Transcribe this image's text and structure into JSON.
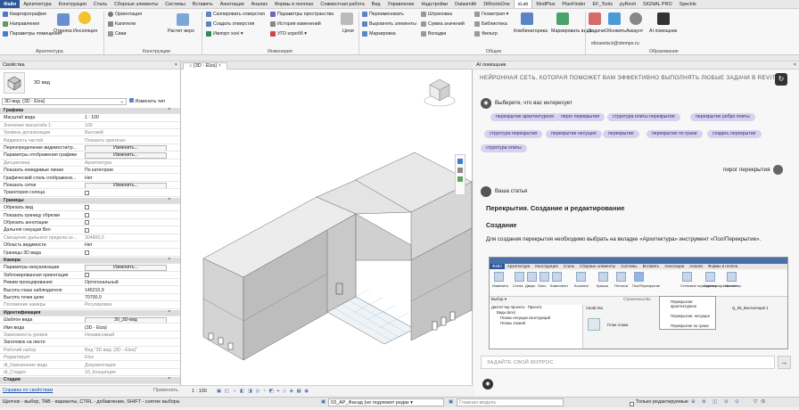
{
  "menu": [
    "Файл",
    "Архитектура",
    "Конструкция",
    "Сталь",
    "Сборные элементы",
    "Системы",
    "Вставить",
    "Аннотации",
    "Анализ",
    "Формы и генплан",
    "Совместная работа",
    "Вид",
    "Управление",
    "Надстройки",
    "Datasmith",
    "DiRootsOne",
    "sLab",
    "ModPlus",
    "PlanFinder",
    "EF_Tools",
    "pyRevit",
    "SIGNAL PRO",
    "Speckle"
  ],
  "menu_active": "sLab",
  "ribbon": {
    "col1": [
      "Квартирография",
      "Направления",
      "Параметры помещения"
    ],
    "g1_big": [
      "Отделка",
      "Инсоляция"
    ],
    "col2": [
      "Ориентация",
      "Капители",
      "Сваи"
    ],
    "g2_big": "Расчет веро",
    "col3": [
      "Скопировать отверстия",
      "Создать отверстия",
      "Импорт xcel ▾"
    ],
    "col4": [
      "Параметры пространства",
      "История изменений",
      "УГО коробб ▾"
    ],
    "g3_big": "Цепи",
    "col5": [
      "Переименовать",
      "Выровнять элементы",
      "Маркировка"
    ],
    "col6": [
      "Штриховка",
      "Сумма значений",
      "Вкладки"
    ],
    "col7": [
      "Геометрия ▾",
      "Библиотека",
      "Фильтр"
    ],
    "g4_big": [
      "Комбинаторика",
      "Маркировать виды"
    ],
    "g5_big": [
      "Задачи",
      "Обновить",
      "Аккаунт",
      "AI помощник"
    ],
    "email": "elizaveta.k@stemps.ru",
    "groups": [
      "Архитектура",
      "Конструкции",
      "Инженерия",
      "Общее",
      "Образование"
    ]
  },
  "properties": {
    "title": "Свойства",
    "close": "×",
    "type_name": "3D вид",
    "selector": "3D вид: {3D - Elza}",
    "edit_type": "Изменить тип",
    "rows": [
      {
        "k": "Графика",
        "v": "",
        "t": "section"
      },
      {
        "k": "Масштаб вида",
        "v": "1 : 100"
      },
      {
        "k": "Значение масштаба   1:",
        "v": "100",
        "t": "grey"
      },
      {
        "k": "Уровень детализации",
        "v": "Высокий",
        "t": "grey"
      },
      {
        "k": "Видимость частей",
        "v": "Показать оригинал",
        "t": "grey"
      },
      {
        "k": "Переопределение видимости/гр...",
        "v": "Изменить...",
        "t": "btn"
      },
      {
        "k": "Параметры отображения графики",
        "v": "Изменить...",
        "t": "btn"
      },
      {
        "k": "Дисциплина",
        "v": "Архитектура",
        "t": "grey"
      },
      {
        "k": "Показать невидимые линии",
        "v": "По категории"
      },
      {
        "k": "Графический стиль отображени...",
        "v": "Нет"
      },
      {
        "k": "Показать сетки",
        "v": "Изменить...",
        "t": "btn"
      },
      {
        "k": "Траектория солнца",
        "v": "",
        "t": "chk"
      },
      {
        "k": "Границы",
        "v": "",
        "t": "section"
      },
      {
        "k": "Обрезать вид",
        "v": "",
        "t": "chk"
      },
      {
        "k": "Показать границу обрезки",
        "v": "",
        "t": "chk"
      },
      {
        "k": "Обрезать аннотации",
        "v": "",
        "t": "chk"
      },
      {
        "k": "Дальняя секущая Вкл",
        "v": "",
        "t": "chk"
      },
      {
        "k": "Смещение дальнего предела се...",
        "v": "304800,0",
        "t": "grey"
      },
      {
        "k": "Область видимости",
        "v": "Нет"
      },
      {
        "k": "Границы 3D вида",
        "v": "",
        "t": "chk"
      },
      {
        "k": "Камера",
        "v": "",
        "t": "section"
      },
      {
        "k": "Параметры визуализации",
        "v": "Изменить...",
        "t": "btn"
      },
      {
        "k": "Заблокированная ориентация",
        "v": "",
        "t": "chk"
      },
      {
        "k": "Режим проецирования",
        "v": "Ортогональный"
      },
      {
        "k": "Высота глаза наблюдателя",
        "v": "145210,9"
      },
      {
        "k": "Высота точки цели",
        "v": "70700,0"
      },
      {
        "k": "Положение камеры",
        "v": "Регулировка",
        "t": "grey"
      },
      {
        "k": "Идентификация",
        "v": "",
        "t": "section"
      },
      {
        "k": "Шаблон вида",
        "v": "30_3D-вид",
        "t": "btn"
      },
      {
        "k": "Имя вида",
        "v": "{3D - Elza}"
      },
      {
        "k": "Зависимость уровня",
        "v": "Независимый",
        "t": "grey"
      },
      {
        "k": "Заголовок на листе",
        "v": ""
      },
      {
        "k": "Рабочий набор",
        "v": "Вид \"3D вид: {3D - Elza}\"",
        "t": "grey"
      },
      {
        "k": "Редактирует",
        "v": "Elza",
        "t": "grey"
      },
      {
        "k": "dt_Назначение вида",
        "v": "Документация",
        "t": "grey"
      },
      {
        "k": "dt_Стадия",
        "v": "10_Концепция",
        "t": "grey"
      },
      {
        "k": "Стадии",
        "v": "",
        "t": "section"
      }
    ],
    "help_link": "Справка по свойствам",
    "apply": "Применить"
  },
  "view": {
    "tab": "{3D - Elza}",
    "scale": "1 : 100"
  },
  "ai": {
    "title": "AI помощник",
    "close": "×",
    "banner": "НЕЙРОННАЯ СЕТЬ, КОТОРАЯ ПОМОЖЕТ ВАМ ЭФФЕКТИВНО ВЫПОЛНЯТЬ ЛЮБЫЕ ЗАДАЧИ В REVIT.",
    "choose": "Выберите, что вас интересует",
    "chips": [
      "перекрытие архитектурное",
      "пирог перекрытия",
      "структура плиты перекрытия",
      "перекрытие ребро плиты",
      "структура перекрытия",
      "перекрытие несущее",
      "перекрытие",
      "перекрытие по грани",
      "создать перекрытие",
      "структура плиты"
    ],
    "user_msg": "пирог перекрытия",
    "answer_label": "Ваша статья",
    "article_title": "Перекрытия. Создание и редактирование",
    "section_title": "Создание",
    "paragraph": "Для создания перекрытия необходимо выбрать на вкладке «Архитектура» инструмент «Пол/Перекрытие».",
    "shot_menu": [
      "Файл",
      "Архитектура",
      "Конструкция",
      "Сталь",
      "Сборные элементы",
      "Системы",
      "Вставить",
      "Аннотации",
      "Анализ",
      "Формы и генпла"
    ],
    "shot_tools": [
      "Изменить",
      "Стена",
      "Дверь",
      "Окно",
      "Компонент",
      "Колонна",
      "Крыша",
      "Потолок",
      "Пол/Перекрытие",
      "Стеновое ограждение",
      "Схема разрезки стены",
      "Импост"
    ],
    "shot_dropdown": [
      "Перекрытие: архитектурное",
      "Перекрытие: несущее",
      "Перекрытие по грани"
    ],
    "shot_left": [
      "Диспетчер проекта - Проект1",
      "Виды (все)",
      "Планы несущих конструкций",
      "Планы этажей"
    ],
    "shot_props": "Свойства",
    "shot_plan": "План этажа",
    "shot_select": "Выбор ▾",
    "shot_build": "Строительство",
    "shot_tab": "Q_08_Вентиляция 1",
    "input_placeholder": "ЗАДАЙТЕ СВОЙ ВОПРОС",
    "send": "→"
  },
  "status": {
    "hint": "Щелчок - выбор, TAB - варианты, CTRL - добавление, SHIFT - снятие выбора.",
    "workset": "03_АР_Фасад (не подлежит редак ▾",
    "model": "Главная модель",
    "editable_only": "Только редактируемые",
    "zero": ":0"
  },
  "colors": {
    "accent": "#2b5797",
    "chip": "#d7d1ee",
    "wall": "#cfcfcf"
  }
}
